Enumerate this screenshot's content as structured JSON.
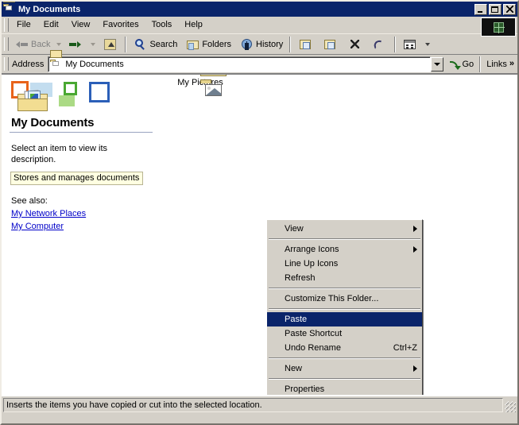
{
  "window": {
    "title": "My Documents",
    "title_icon": "folder-documents-icon",
    "controls": {
      "minimize": "Minimize",
      "maximize": "Maximize",
      "close": "Close"
    }
  },
  "menubar": {
    "items": [
      {
        "label": "File"
      },
      {
        "label": "Edit"
      },
      {
        "label": "View"
      },
      {
        "label": "Favorites"
      },
      {
        "label": "Tools"
      },
      {
        "label": "Help"
      }
    ],
    "brand_icon": "windows-flag-icon"
  },
  "toolbar": {
    "back": {
      "label": "Back",
      "icon": "arrow-left-icon",
      "disabled": true
    },
    "forward": {
      "label": "",
      "icon": "arrow-right-icon",
      "disabled": false
    },
    "up": {
      "label": "",
      "icon": "folder-up-icon"
    },
    "search": {
      "label": "Search",
      "icon": "search-icon"
    },
    "folders": {
      "label": "Folders",
      "icon": "folders-icon"
    },
    "history": {
      "label": "History",
      "icon": "history-icon"
    },
    "move_to": {
      "label": "",
      "icon": "move-to-icon"
    },
    "copy_to": {
      "label": "",
      "icon": "copy-to-icon"
    },
    "delete": {
      "label": "",
      "icon": "delete-icon"
    },
    "undo": {
      "label": "",
      "icon": "undo-icon"
    },
    "views": {
      "label": "",
      "icon": "views-icon"
    }
  },
  "address": {
    "label": "Address",
    "value": "My Documents",
    "placeholder": "Address",
    "icon": "folder-documents-icon",
    "dropdown_icon": "chevron-down-icon",
    "go_label": "Go",
    "go_icon": "go-arrow-icon",
    "links_label": "Links",
    "links_chevron": "»"
  },
  "info_pane": {
    "banner_icon": "my-documents-banner-icon",
    "title": "My Documents",
    "description": "Select an item to view its description.",
    "tooltip": "Stores and manages documents",
    "see_also_label": "See also:",
    "links": [
      {
        "label": "My Network Places"
      },
      {
        "label": "My Computer"
      }
    ],
    "link_color": "#0000c8",
    "tooltip_bg": "#ffffe1"
  },
  "files": [
    {
      "label": "My Pictures",
      "icon": "folder-pictures-icon"
    }
  ],
  "context_menu": {
    "highlight_color": "#0a246a",
    "items": [
      {
        "label": "View",
        "submenu": true,
        "separator_after": true
      },
      {
        "label": "Arrange Icons",
        "submenu": true
      },
      {
        "label": "Line Up Icons"
      },
      {
        "label": "Refresh",
        "separator_after": true
      },
      {
        "label": "Customize This Folder...",
        "separator_after": true
      },
      {
        "label": "Paste",
        "selected": true
      },
      {
        "label": "Paste Shortcut"
      },
      {
        "label": "Undo Rename",
        "accel": "Ctrl+Z",
        "separator_after": true
      },
      {
        "label": "New",
        "submenu": true,
        "separator_after": true
      },
      {
        "label": "Properties"
      }
    ]
  },
  "statusbar": {
    "text": "Inserts the items you have copied or cut into the selected location.",
    "grip_icon": "resize-grip-icon"
  }
}
